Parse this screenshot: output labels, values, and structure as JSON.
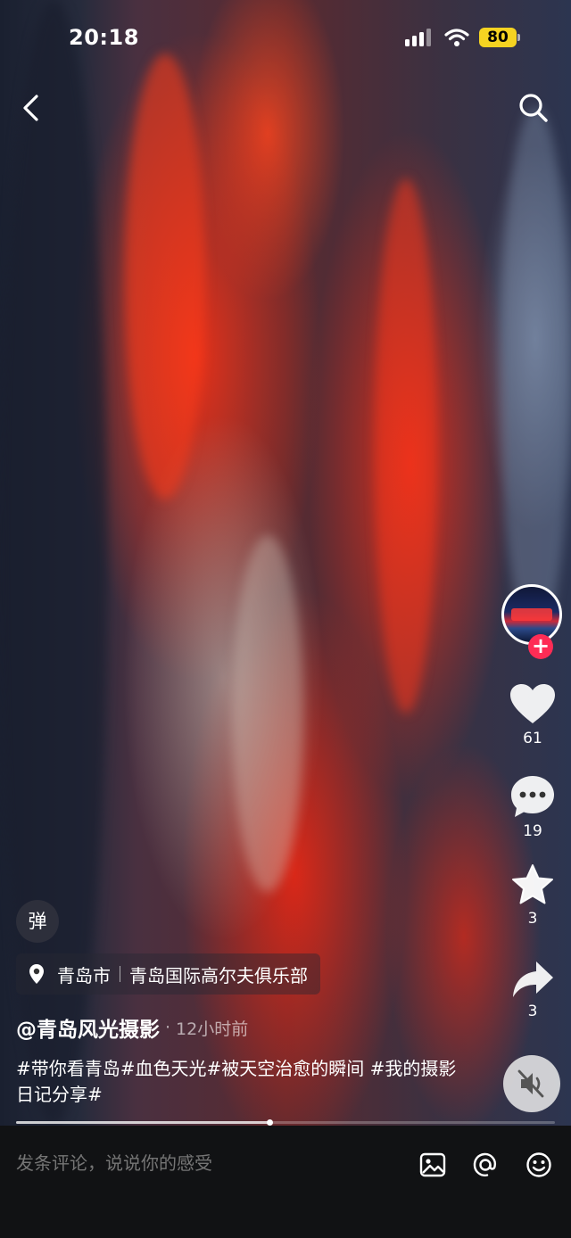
{
  "status_bar": {
    "time": "20:18",
    "battery": "80",
    "icons": [
      "signal-icon",
      "wifi-icon",
      "battery-icon"
    ]
  },
  "top_nav": {
    "back_icon": "chevron-left-icon",
    "search_icon": "search-icon"
  },
  "actions": {
    "follow_icon": "plus-icon",
    "like_count": "61",
    "comment_count": "19",
    "favorite_count": "3",
    "share_count": "3"
  },
  "danmu": {
    "label": "弹"
  },
  "location": {
    "city": "青岛市",
    "place": "青岛国际高尔夫俱乐部"
  },
  "post": {
    "author": "@青岛风光摄影",
    "separator": "·",
    "time_ago": "12小时前",
    "caption": "#带你看青岛#血色天光#被天空治愈的瞬间 #我的摄影日记分享#"
  },
  "playback": {
    "progress": 0.47,
    "muted": true
  },
  "comment_bar": {
    "placeholder": "发条评论，说说你的感受",
    "icons": [
      "image-icon",
      "at-icon",
      "emoji-icon"
    ]
  },
  "colors": {
    "accent": "#fe2c55",
    "battery": "#f5d321",
    "bar_bg": "#111214"
  }
}
